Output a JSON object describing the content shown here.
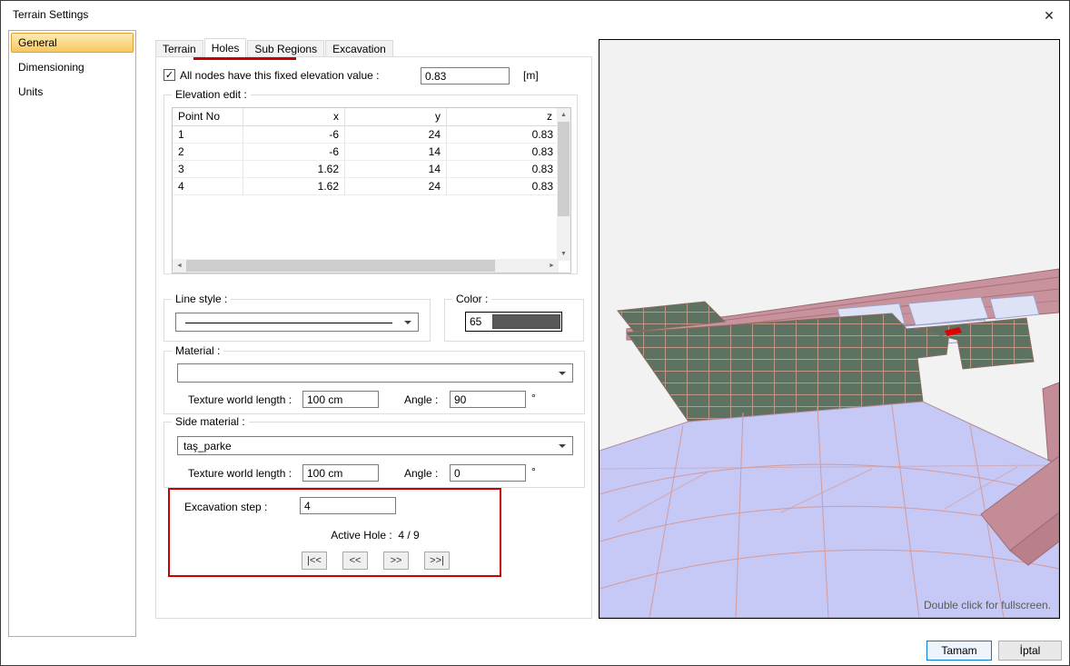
{
  "window": {
    "title": "Terrain Settings"
  },
  "icons": {
    "close": "✕",
    "check": "✓",
    "scroll_up": "▲",
    "scroll_down": "▼",
    "scroll_left": "◄",
    "scroll_right": "►"
  },
  "accent": {
    "red": "#c80000"
  },
  "sidebar": {
    "items": [
      "General",
      "Dimensioning",
      "Units"
    ],
    "selected": "General"
  },
  "tabs": [
    "Terrain",
    "Holes",
    "Sub Regions",
    "Excavation"
  ],
  "active_tab": "Holes",
  "fixed_elevation": {
    "label": "All nodes have this fixed elevation value :",
    "value": "0.83",
    "unit": "[m]",
    "checked": true
  },
  "elevation_edit": {
    "title": "Elevation edit :",
    "columns": [
      "Point No",
      "x",
      "y",
      "z"
    ],
    "rows": [
      [
        "1",
        "-6",
        "24",
        "0.83"
      ],
      [
        "2",
        "-6",
        "14",
        "0.83"
      ],
      [
        "3",
        "1.62",
        "14",
        "0.83"
      ],
      [
        "4",
        "1.62",
        "24",
        "0.83"
      ]
    ]
  },
  "line_style": {
    "title": "Line style :"
  },
  "color": {
    "title": "Color :",
    "value": "65",
    "swatch_color": "#58595b"
  },
  "material": {
    "title": "Material :",
    "selected": "",
    "texture_label": "Texture world length :",
    "texture_value": "100 cm",
    "angle_label": "Angle :",
    "angle_value": "90",
    "angle_unit": "°"
  },
  "side_material": {
    "title": "Side material :",
    "selected": "taş_parke",
    "texture_label": "Texture world length :",
    "texture_value": "100 cm",
    "angle_label": "Angle :",
    "angle_value": "0",
    "angle_unit": "°"
  },
  "excavation_nav": {
    "step_label": "Excavation step :",
    "step_value": "4",
    "active_hole_label": "Active Hole :  4 / 9",
    "first": "|<<",
    "prev": "<<",
    "next": ">>",
    "last": ">>|"
  },
  "preview": {
    "caption": "Double click for fullscreen."
  },
  "footer": {
    "ok": "Tamam",
    "cancel": "İptal"
  }
}
